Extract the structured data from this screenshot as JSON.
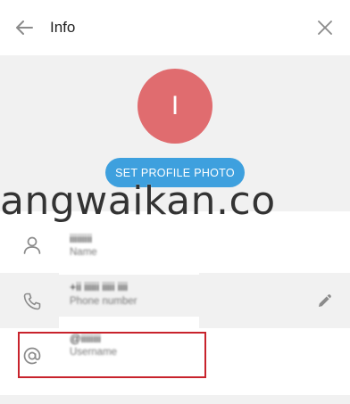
{
  "header": {
    "title": "Info"
  },
  "profile": {
    "avatar_letter": "I",
    "avatar_color": "#e06c6f",
    "set_photo_label": "SET PROFILE PHOTO",
    "button_color": "#3ea0de"
  },
  "watermark": {
    "text": "angwaikan.co"
  },
  "rows": [
    {
      "icon": "user-icon",
      "value": "iiiiiiiii",
      "label": "Name"
    },
    {
      "icon": "phone-icon",
      "value": "+ii iiiiii iiiii iiii",
      "label": "Phone number"
    },
    {
      "icon": "at-icon",
      "value": "@iiiiiiii",
      "label": "Username"
    }
  ],
  "colors": {
    "highlight": "#c8232c"
  }
}
